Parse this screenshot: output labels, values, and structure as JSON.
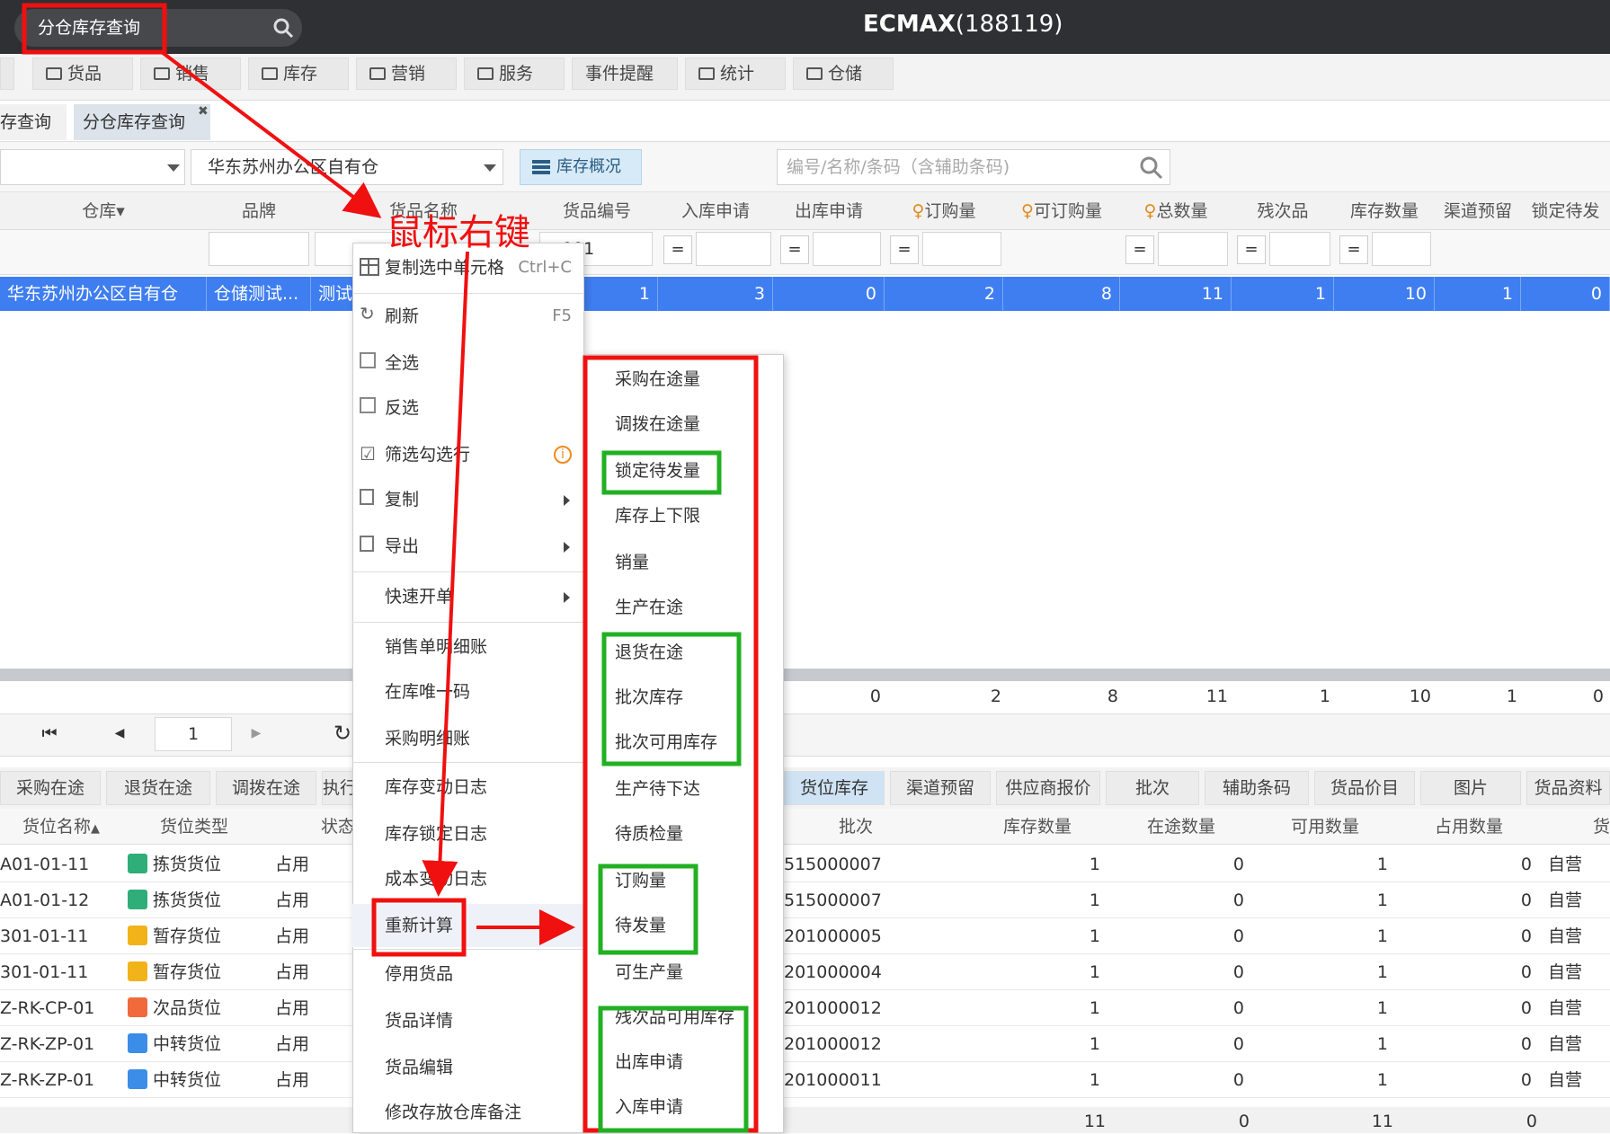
{
  "topbar": {
    "search_label": "分仓库存查询",
    "title_prefix": "ECMAX",
    "title_id": "(188119)"
  },
  "menu": [
    "货品",
    "销售",
    "库存",
    "营销",
    "服务",
    "事件提醒",
    "统计",
    "仓储"
  ],
  "tabs": {
    "prev": "存查询",
    "active": "分仓库存查询"
  },
  "filters": {
    "warehouse": "华东苏州办公区自有仓",
    "overview_button": "库存概况",
    "search_placeholder": "编号/名称/条码（含辅助条码)"
  },
  "grid": {
    "headers": [
      "仓库",
      "品牌",
      "货品名称",
      "货品编号",
      "入库申请",
      "出库申请",
      "订购量",
      "可订购量",
      "总数量",
      "残次品",
      "库存数量",
      "渠道预留",
      "锁定待发"
    ],
    "filter_text": "001",
    "eq": "=",
    "row": [
      "华东苏州办公区自有仓",
      "仓储测试...",
      "测试",
      "1",
      "3",
      "0",
      "2",
      "8",
      "11",
      "1",
      "10",
      "1",
      "0"
    ],
    "summary": [
      "0",
      "2",
      "8",
      "11",
      "1",
      "10",
      "1",
      "0"
    ]
  },
  "pager": {
    "page": "1"
  },
  "bottom_tabs_left": [
    "采购在途",
    "退货在途",
    "调拨在途",
    "执行"
  ],
  "bottom_tabs_right": [
    "货位库存",
    "渠道预留",
    "供应商报价",
    "批次",
    "辅助条码",
    "货品价目",
    "图片",
    "货品资料"
  ],
  "bottom_headers_left": [
    "货位名称",
    "货位类型",
    "状态"
  ],
  "bottom_headers_right": [
    "批次",
    "库存数量",
    "在途数量",
    "可用数量",
    "占用数量",
    "货"
  ],
  "bottom_rows": [
    {
      "loc": "A01-01-11",
      "type": "拣货货位",
      "status": "占用",
      "batch": "515000007",
      "qty": "1",
      "transit": "0",
      "avail": "1",
      "occ": "0",
      "own": "自营"
    },
    {
      "loc": "A01-01-12",
      "type": "拣货货位",
      "status": "占用",
      "batch": "515000007",
      "qty": "1",
      "transit": "0",
      "avail": "1",
      "occ": "0",
      "own": "自营"
    },
    {
      "loc": "301-01-11",
      "type": "暂存货位",
      "status": "占用",
      "batch": "201000005",
      "qty": "1",
      "transit": "0",
      "avail": "1",
      "occ": "0",
      "own": "自营"
    },
    {
      "loc": "301-01-11",
      "type": "暂存货位",
      "status": "占用",
      "batch": "201000004",
      "qty": "1",
      "transit": "0",
      "avail": "1",
      "occ": "0",
      "own": "自营"
    },
    {
      "loc": "Z-RK-CP-01",
      "type": "次品货位",
      "status": "占用",
      "batch": "201000012",
      "qty": "1",
      "transit": "0",
      "avail": "1",
      "occ": "0",
      "own": "自营"
    },
    {
      "loc": "Z-RK-ZP-01",
      "type": "中转货位",
      "status": "占用",
      "batch": "201000012",
      "qty": "1",
      "transit": "0",
      "avail": "1",
      "occ": "0",
      "own": "自营"
    },
    {
      "loc": "Z-RK-ZP-01",
      "type": "中转货位",
      "status": "占用",
      "batch": "201000011",
      "qty": "1",
      "transit": "0",
      "avail": "1",
      "occ": "0",
      "own": "自营"
    }
  ],
  "bottom_totals": [
    "11",
    "0",
    "11",
    "0"
  ],
  "context_menu": {
    "copy_cell": "复制选中单元格",
    "copy_cell_key": "Ctrl+C",
    "refresh": "刷新",
    "refresh_key": "F5",
    "select_all": "全选",
    "invert": "反选",
    "filter_checked": "筛选勾选行",
    "copy": "复制",
    "export": "导出",
    "quick_order": "快速开单",
    "sales_detail": "销售单明细账",
    "unique_code": "在库唯一码",
    "purchase_detail": "采购明细账",
    "stock_log": "库存变动日志",
    "lock_log": "库存锁定日志",
    "cost_log": "成本变动日志",
    "recalc": "重新计算",
    "disable": "停用货品",
    "goods_detail": "货品详情",
    "goods_edit": "货品编辑",
    "remark": "修改存放仓库备注"
  },
  "submenu": [
    "采购在途量",
    "调拨在途量",
    "锁定待发量",
    "库存上下限",
    "销量",
    "生产在途",
    "退货在途",
    "批次库存",
    "批次可用库存",
    "生产待下达",
    "待质检量",
    "订购量",
    "待发量",
    "可生产量",
    "残次品可用库存",
    "出库申请",
    "入库申请"
  ],
  "annotation": {
    "right_click": "鼠标右键"
  },
  "colors": {
    "highlight_row": "#3f7ef0",
    "annotation_red": "#f01010",
    "annotation_green": "#22b022",
    "topbar": "#2f3033"
  }
}
